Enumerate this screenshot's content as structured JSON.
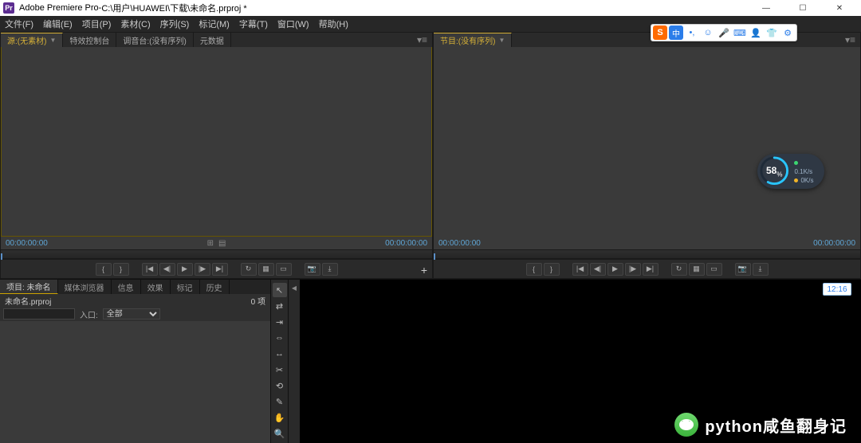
{
  "window": {
    "app_name": "Adobe Premiere Pro",
    "title_sep": " - ",
    "file_path": "C:\\用户\\HUAWEI\\下载\\未命名.prproj *",
    "logo_text": "Pr"
  },
  "menu": [
    "文件(F)",
    "编辑(E)",
    "项目(P)",
    "素材(C)",
    "序列(S)",
    "标记(M)",
    "字幕(T)",
    "窗口(W)",
    "帮助(H)"
  ],
  "source_panel": {
    "tabs": [
      {
        "label": "源:(无素材)",
        "active": true,
        "has_dd": true
      },
      {
        "label": "特效控制台",
        "active": false
      },
      {
        "label": "调音台:(没有序列)",
        "active": false
      },
      {
        "label": "元数据",
        "active": false
      }
    ],
    "tc_left": "00:00:00:00",
    "tc_right": "00:00:00:00"
  },
  "program_panel": {
    "tab_label": "节目:(没有序列)",
    "tc_left": "00:00:00:00",
    "tc_right": "00:00:00:00"
  },
  "project_panel": {
    "tabs": [
      "项目: 未命名",
      "媒体浏览器",
      "信息",
      "效果",
      "标记",
      "历史"
    ],
    "active_tab": 0,
    "file_label": "未命名.prproj",
    "item_count": "0 项",
    "filter_label": "入口:",
    "filter_value": "全部"
  },
  "tools": [
    "selection",
    "track-select",
    "ripple",
    "rolling",
    "rate-stretch",
    "razor",
    "slip",
    "pen",
    "hand",
    "zoom"
  ],
  "tool_glyphs": [
    "↖",
    "⇄",
    "⇥",
    "⇔",
    "↔",
    "✂",
    "⟲",
    "✎",
    "✋",
    "🔍"
  ],
  "ime": {
    "logo": "S",
    "cn": "中",
    "punct": "•,",
    "face": "☺",
    "mic": "🎤",
    "kbd": "⌨",
    "user": "👤",
    "skin": "👕",
    "set": "⚙"
  },
  "clock": "12:16",
  "gauge": {
    "percent": "58",
    "unit": "%",
    "up": "0.1K/s",
    "down": "0K/s"
  },
  "watermark": "python咸鱼翻身记",
  "transport_glyphs": {
    "mark_in": "{",
    "mark_out": "}",
    "set_in": "⎡",
    "set_out": "⎦",
    "goto_in": "|◀",
    "step_back": "◀|",
    "play": "▶",
    "step_fwd": "|▶",
    "goto_out": "▶|",
    "loop": "↻",
    "safe": "▦",
    "out": "▭",
    "cam": "📷",
    "export": "⤓",
    "plus": "+"
  }
}
